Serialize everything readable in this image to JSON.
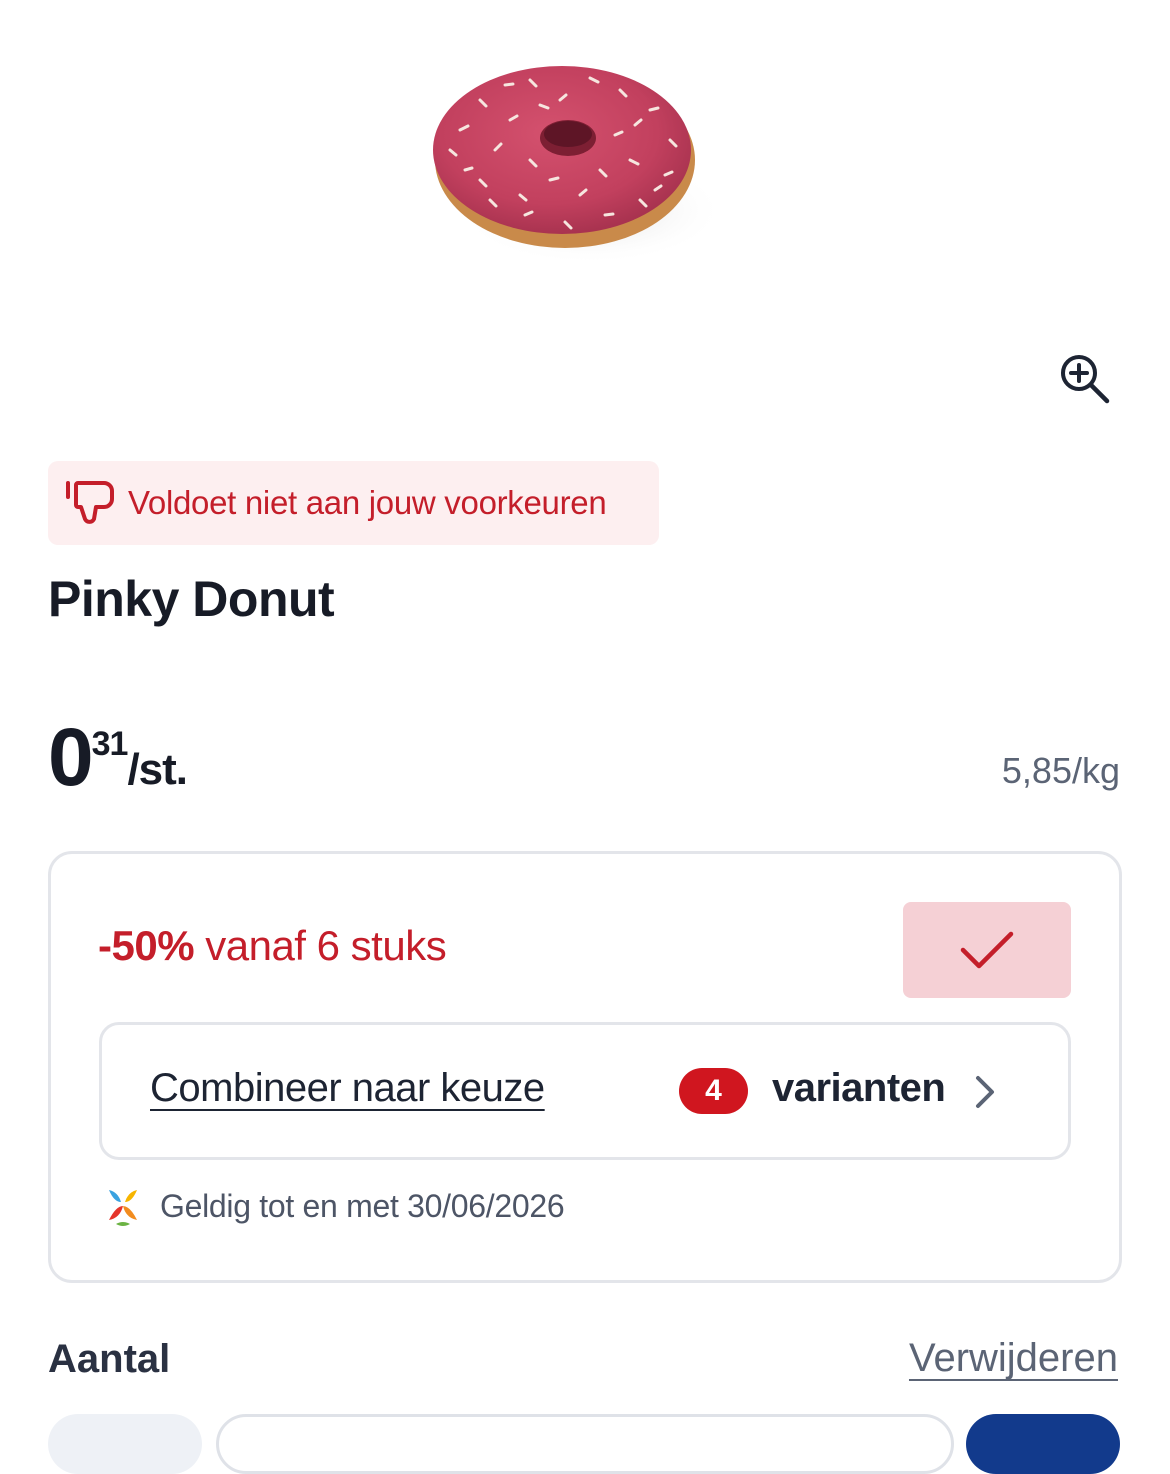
{
  "product": {
    "image_icon": "donut-image",
    "preference_warning": "Voldoet niet aan jouw voorkeuren",
    "title": "Pinky Donut",
    "price_integer": "0",
    "price_cents": "31",
    "price_unit": "/st.",
    "price_per_kg": "5,85/kg"
  },
  "offer": {
    "discount": "-50%",
    "condition": " vanaf 6 stuks",
    "combine_label": "Combineer naar keuze",
    "variant_count": "4",
    "variant_label": "varianten",
    "valid_until": "Geldig tot en met 30/06/2026"
  },
  "quantity": {
    "label": "Aantal",
    "remove_label": "Verwijderen"
  },
  "colors": {
    "accent_red": "#c41e2a",
    "badge_red": "#d0161f",
    "brand_blue": "#123a8c"
  }
}
